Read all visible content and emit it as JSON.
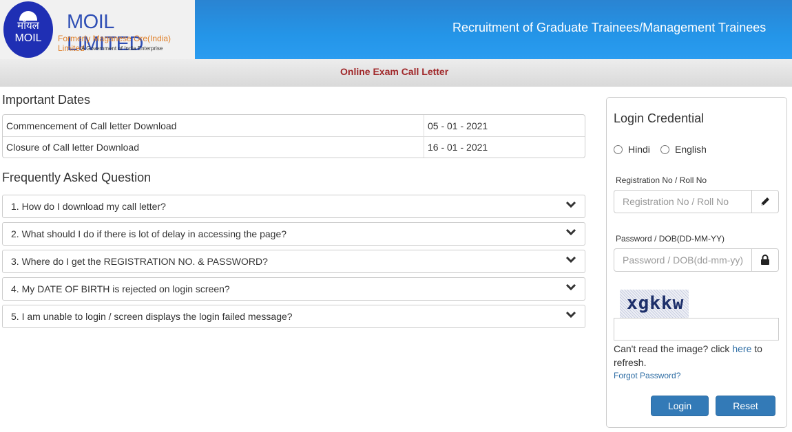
{
  "header": {
    "logo": {
      "hindi_text": "मॉयल",
      "short_name": "MOIL",
      "title": "MOIL LIMITED",
      "subtitle": "Formerly Maganese Ore(India) Limited",
      "tagline": "A Government of India Enterprise"
    },
    "title": "Recruitment of Graduate Trainees/Management Trainees"
  },
  "subbar": {
    "title": "Online Exam Call Letter"
  },
  "important_dates": {
    "heading": "Important Dates",
    "rows": [
      {
        "label": "Commencement of Call letter Download",
        "value": "05 - 01 - 2021"
      },
      {
        "label": "Closure of Call letter Download",
        "value": "16 - 01 - 2021"
      }
    ]
  },
  "faq": {
    "heading": "Frequently Asked Question",
    "items": [
      {
        "question": "1. How do I download my call letter?"
      },
      {
        "question": "2. What should I do if there is lot of delay in accessing the page?"
      },
      {
        "question": "3. Where do I get the REGISTRATION NO. & PASSWORD?"
      },
      {
        "question": "4. My DATE OF BIRTH is rejected on login screen?"
      },
      {
        "question": "5. I am unable to login / screen displays the login failed message?"
      }
    ],
    "expand_icon": "chevron-down-icon"
  },
  "login": {
    "title": "Login Credential",
    "languages": [
      {
        "label": "Hindi",
        "selected": false
      },
      {
        "label": "English",
        "selected": false
      }
    ],
    "registration": {
      "label": "Registration No / Roll No",
      "placeholder": "Registration No / Roll No",
      "value": "",
      "icon": "pencil-icon"
    },
    "password": {
      "label": "Password / DOB(DD-MM-YY)",
      "placeholder": "Password / DOB(dd-mm-yy)",
      "value": "",
      "icon": "lock-icon"
    },
    "captcha": {
      "text": "xgkkw",
      "input_value": ""
    },
    "refresh": {
      "prefix": "Can't read the image? click ",
      "link": "here",
      "suffix": " to refresh."
    },
    "forgot_password": "Forgot Password?",
    "login_button": "Login",
    "reset_button": "Reset"
  },
  "colors": {
    "header_blue": "#2495e8",
    "logo_blue": "#1f2fb4",
    "subbar_title": "#a0282a",
    "button_blue": "#337ab7",
    "link_blue": "#2e6da4"
  }
}
